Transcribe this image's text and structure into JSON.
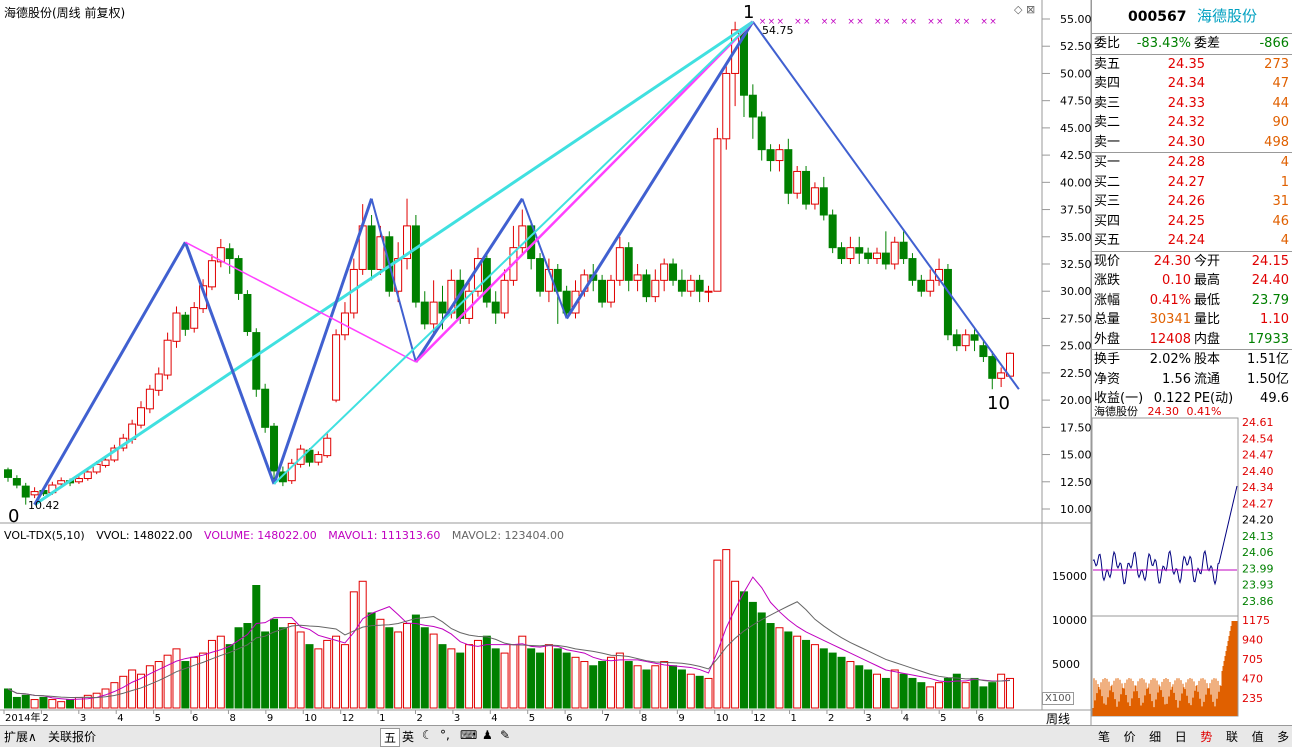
{
  "title": "海德股份(周线 前复权)",
  "volume_legend": {
    "indicator": "VOL-TDX(5,10)",
    "vvol": "VVOL: 148022.00",
    "volume": "VOLUME: 148022.00",
    "mavol1": "MAVOL1: 111313.60",
    "mavol2": "MAVOL2: 123404.00"
  },
  "price_axis": [
    "55.00",
    "52.50",
    "50.00",
    "47.50",
    "45.00",
    "42.50",
    "40.00",
    "37.50",
    "35.00",
    "32.50",
    "30.00",
    "27.50",
    "25.00",
    "22.50",
    "20.00",
    "17.50",
    "15.00",
    "12.50",
    "10.00"
  ],
  "volume_axis": [
    "15000",
    "10000",
    "5000"
  ],
  "x_labels": [
    "2014年",
    "2",
    "3",
    "4",
    "5",
    "6",
    "8",
    "9",
    "10",
    "12",
    "1",
    "2",
    "3",
    "4",
    "5",
    "6",
    "7",
    "8",
    "9",
    "10",
    "12",
    "1",
    "2",
    "3",
    "4",
    "5",
    "6"
  ],
  "period_label": "周线",
  "x100_label": "X100",
  "annotations": {
    "wave_start": "0",
    "wave_peak": "1",
    "wave_end": "10",
    "low_price": "10.42",
    "high_price": "54.75"
  },
  "quote": {
    "code": "000567",
    "name": "海德股份",
    "rows": [
      {
        "l": "委比",
        "v": "-83.43%",
        "l2": "委差",
        "v2": "-866",
        "c1": "green",
        "c2": "green"
      },
      {
        "l": "卖五",
        "v": "24.35",
        "v2": "273",
        "c1": "red",
        "c2": "orange"
      },
      {
        "l": "卖四",
        "v": "24.34",
        "v2": "47",
        "c1": "red",
        "c2": "orange"
      },
      {
        "l": "卖三",
        "v": "24.33",
        "v2": "44",
        "c1": "red",
        "c2": "orange"
      },
      {
        "l": "卖二",
        "v": "24.32",
        "v2": "90",
        "c1": "red",
        "c2": "orange"
      },
      {
        "l": "卖一",
        "v": "24.30",
        "v2": "498",
        "c1": "red",
        "c2": "orange"
      },
      {
        "l": "买一",
        "v": "24.28",
        "v2": "4",
        "c1": "red",
        "c2": "orange"
      },
      {
        "l": "买二",
        "v": "24.27",
        "v2": "1",
        "c1": "red",
        "c2": "orange"
      },
      {
        "l": "买三",
        "v": "24.26",
        "v2": "31",
        "c1": "red",
        "c2": "orange"
      },
      {
        "l": "买四",
        "v": "24.25",
        "v2": "46",
        "c1": "red",
        "c2": "orange"
      },
      {
        "l": "买五",
        "v": "24.24",
        "v2": "4",
        "c1": "red",
        "c2": "orange"
      },
      {
        "l": "现价",
        "v": "24.30",
        "l2": "今开",
        "v2": "24.15",
        "c1": "red",
        "c2": "red"
      },
      {
        "l": "涨跌",
        "v": "0.10",
        "l2": "最高",
        "v2": "24.40",
        "c1": "red",
        "c2": "red"
      },
      {
        "l": "涨幅",
        "v": "0.41%",
        "l2": "最低",
        "v2": "23.79",
        "c1": "red",
        "c2": "green"
      },
      {
        "l": "总量",
        "v": "30341",
        "l2": "量比",
        "v2": "1.10",
        "c1": "orange",
        "c2": "red"
      },
      {
        "l": "外盘",
        "v": "12408",
        "l2": "内盘",
        "v2": "17933",
        "c1": "red",
        "c2": "green"
      },
      {
        "l": "换手",
        "v": "2.02%",
        "l2": "股本",
        "v2": "1.51亿",
        "c1": "black",
        "c2": "black"
      },
      {
        "l": "净资",
        "v": "1.56",
        "l2": "流通",
        "v2": "1.50亿",
        "c1": "black",
        "c2": "black"
      },
      {
        "l": "收益(一)",
        "v": "0.122",
        "l2": "PE(动)",
        "v2": "49.6",
        "c1": "black",
        "c2": "black"
      }
    ]
  },
  "intraday": {
    "name": "海德股份",
    "price": "24.30",
    "change": "0.41%",
    "price_axis": [
      "24.61",
      "24.54",
      "24.47",
      "24.40",
      "24.34",
      "24.27",
      "24.20",
      "24.13",
      "24.06",
      "23.99",
      "23.93",
      "23.86"
    ],
    "vol_axis": [
      "1175",
      "940",
      "705",
      "470",
      "235"
    ]
  },
  "bottom_tabs": [
    "扩展∧",
    "关联报价"
  ],
  "toolbar": [
    "五",
    "英"
  ],
  "right_tabs": [
    "笔",
    "价",
    "细",
    "日",
    "势",
    "联",
    "值",
    "多"
  ],
  "chart_data": {
    "type": "candlestick",
    "title": "海德股份(周线 前复权)",
    "ylim": [
      8,
      56
    ],
    "candles": [
      [
        13.6,
        12.9,
        13.8,
        12.5
      ],
      [
        12.8,
        12.2,
        13.1,
        11.9
      ],
      [
        12.1,
        11.1,
        12.4,
        10.4
      ],
      [
        11.3,
        11.6,
        12.0,
        11.0
      ],
      [
        11.7,
        11.4,
        11.9,
        11.2
      ],
      [
        11.5,
        12.2,
        12.5,
        11.3
      ],
      [
        12.3,
        12.6,
        12.9,
        12.1
      ],
      [
        12.6,
        12.4,
        12.8,
        12.1
      ],
      [
        12.5,
        12.8,
        13.0,
        12.3
      ],
      [
        12.8,
        13.4,
        13.7,
        12.6
      ],
      [
        13.4,
        14.1,
        14.4,
        13.2
      ],
      [
        14.0,
        14.5,
        14.9,
        13.8
      ],
      [
        14.5,
        15.6,
        15.9,
        14.3
      ],
      [
        15.6,
        16.5,
        16.9,
        15.3
      ],
      [
        16.4,
        17.8,
        18.2,
        16.0
      ],
      [
        17.7,
        19.3,
        19.9,
        17.4
      ],
      [
        19.2,
        21.0,
        21.4,
        18.8
      ],
      [
        20.9,
        22.4,
        23.0,
        20.4
      ],
      [
        22.3,
        25.5,
        26.2,
        21.9
      ],
      [
        25.4,
        28.0,
        28.6,
        24.8
      ],
      [
        27.8,
        26.5,
        28.1,
        25.9
      ],
      [
        26.6,
        28.5,
        29.0,
        26.2
      ],
      [
        28.4,
        30.5,
        31.1,
        28.0
      ],
      [
        30.4,
        32.8,
        33.4,
        30.1
      ],
      [
        32.7,
        34.0,
        34.8,
        32.2
      ],
      [
        33.9,
        33.0,
        34.4,
        31.6
      ],
      [
        33.0,
        29.8,
        33.3,
        29.2
      ],
      [
        29.7,
        26.3,
        30.1,
        25.9
      ],
      [
        26.2,
        21.0,
        26.6,
        20.3
      ],
      [
        21.0,
        17.5,
        21.5,
        17.0
      ],
      [
        17.6,
        13.5,
        17.9,
        12.3
      ],
      [
        13.4,
        12.5,
        13.9,
        12.1
      ],
      [
        12.6,
        14.2,
        14.6,
        12.3
      ],
      [
        14.1,
        15.5,
        15.9,
        13.8
      ],
      [
        15.4,
        14.3,
        15.6,
        13.9
      ],
      [
        14.3,
        15.0,
        15.3,
        14.0
      ],
      [
        14.9,
        16.5,
        17.0,
        14.7
      ],
      [
        20.0,
        26.0,
        26.5,
        19.8
      ],
      [
        26.0,
        28.0,
        29.0,
        25.5
      ],
      [
        28.0,
        32.0,
        33.0,
        27.5
      ],
      [
        32.0,
        36.0,
        38.0,
        31.5
      ],
      [
        36.0,
        32.0,
        37.0,
        31.0
      ],
      [
        32.0,
        35.0,
        36.0,
        31.5
      ],
      [
        35.0,
        30.0,
        35.5,
        29.5
      ],
      [
        30.0,
        33.0,
        34.5,
        29.0
      ],
      [
        33.0,
        36.0,
        38.5,
        32.0
      ],
      [
        36.0,
        29.0,
        37.0,
        28.5
      ],
      [
        29.0,
        27.0,
        30.0,
        26.5
      ],
      [
        27.0,
        29.0,
        31.0,
        26.0
      ],
      [
        29.0,
        28.0,
        30.5,
        26.5
      ],
      [
        28.0,
        31.0,
        32.0,
        27.5
      ],
      [
        31.0,
        27.5,
        32.0,
        27.0
      ],
      [
        27.5,
        30.0,
        31.0,
        27.0
      ],
      [
        30.0,
        33.0,
        34.0,
        29.5
      ],
      [
        33.0,
        29.0,
        33.5,
        28.5
      ],
      [
        29.0,
        28.0,
        30.0,
        27.0
      ],
      [
        28.0,
        31.0,
        32.0,
        27.5
      ],
      [
        31.0,
        34.0,
        36.0,
        30.5
      ],
      [
        34.0,
        36.0,
        37.5,
        33.5
      ],
      [
        36.0,
        33.0,
        36.5,
        32.0
      ],
      [
        33.0,
        30.0,
        33.5,
        29.5
      ],
      [
        30.0,
        32.0,
        33.0,
        29.0
      ],
      [
        32.0,
        30.0,
        32.5,
        27.0
      ],
      [
        30.0,
        28.0,
        30.5,
        27.5
      ],
      [
        28.0,
        30.0,
        31.0,
        27.5
      ],
      [
        30.0,
        31.5,
        32.0,
        29.5
      ],
      [
        31.5,
        31.0,
        32.5,
        30.0
      ],
      [
        31.0,
        29.0,
        31.5,
        28.5
      ],
      [
        29.0,
        31.0,
        31.5,
        28.5
      ],
      [
        31.0,
        34.0,
        35.0,
        30.5
      ],
      [
        34.0,
        31.0,
        34.5,
        30.0
      ],
      [
        31.0,
        31.5,
        32.5,
        30.0
      ],
      [
        31.5,
        29.5,
        32.0,
        29.0
      ],
      [
        29.5,
        31.0,
        32.0,
        29.0
      ],
      [
        31.0,
        32.5,
        33.0,
        30.0
      ],
      [
        32.5,
        31.0,
        33.0,
        30.5
      ],
      [
        31.0,
        30.0,
        32.0,
        29.5
      ],
      [
        30.0,
        31.0,
        31.5,
        29.5
      ],
      [
        31.0,
        30.0,
        31.5,
        29.0
      ],
      [
        30.0,
        30.0,
        30.5,
        29.0
      ],
      [
        30.0,
        44.0,
        45.0,
        30.0
      ],
      [
        44.0,
        50.0,
        51.0,
        43.0
      ],
      [
        50.0,
        54.0,
        54.75,
        47.0
      ],
      [
        54.0,
        48.0,
        54.0,
        46.0
      ],
      [
        48.0,
        46.0,
        49.0,
        44.0
      ],
      [
        46.0,
        43.0,
        46.5,
        42.0
      ],
      [
        43.0,
        42.0,
        43.5,
        41.0
      ],
      [
        42.0,
        43.0,
        43.5,
        41.0
      ],
      [
        43.0,
        39.0,
        44.0,
        38.0
      ],
      [
        39.0,
        41.0,
        41.5,
        38.5
      ],
      [
        41.0,
        38.0,
        41.5,
        37.5
      ],
      [
        38.0,
        39.5,
        40.0,
        37.5
      ],
      [
        39.5,
        37.0,
        40.5,
        36.5
      ],
      [
        37.0,
        34.0,
        37.5,
        33.5
      ],
      [
        34.0,
        33.0,
        34.5,
        32.5
      ],
      [
        33.0,
        34.0,
        35.0,
        32.5
      ],
      [
        34.0,
        33.5,
        35.0,
        32.5
      ],
      [
        33.5,
        33.0,
        34.0,
        32.5
      ],
      [
        33.0,
        33.5,
        34.0,
        32.5
      ],
      [
        33.5,
        32.5,
        35.5,
        32.0
      ],
      [
        32.5,
        34.5,
        35.0,
        32.0
      ],
      [
        34.5,
        33.0,
        35.5,
        32.5
      ],
      [
        33.0,
        31.0,
        33.5,
        30.5
      ],
      [
        31.0,
        30.0,
        31.5,
        29.5
      ],
      [
        30.0,
        31.0,
        32.0,
        29.5
      ],
      [
        31.0,
        32.0,
        33.0,
        30.5
      ],
      [
        32.0,
        26.0,
        32.5,
        25.5
      ],
      [
        26.0,
        25.0,
        26.5,
        24.5
      ],
      [
        25.0,
        26.0,
        26.5,
        24.5
      ],
      [
        26.0,
        25.5,
        26.5,
        24.5
      ],
      [
        25.0,
        24.0,
        25.5,
        23.5
      ],
      [
        24.0,
        22.0,
        24.5,
        21.0
      ],
      [
        22.0,
        22.5,
        23.0,
        21.2
      ],
      [
        22.2,
        24.3,
        24.4,
        22.0
      ]
    ],
    "volume": [
      9,
      5,
      6,
      4,
      5,
      4,
      3,
      4,
      5,
      6,
      7,
      9,
      12,
      15,
      18,
      16,
      20,
      22,
      25,
      28,
      22,
      24,
      26,
      32,
      34,
      30,
      38,
      40,
      58,
      36,
      42,
      38,
      40,
      36,
      30,
      28,
      32,
      34,
      30,
      55,
      60,
      45,
      42,
      38,
      36,
      40,
      44,
      38,
      35,
      30,
      28,
      26,
      30,
      32,
      34,
      28,
      26,
      30,
      34,
      28,
      26,
      30,
      28,
      26,
      24,
      22,
      20,
      22,
      24,
      26,
      22,
      20,
      18,
      20,
      22,
      20,
      18,
      16,
      15,
      14,
      70,
      75,
      60,
      55,
      50,
      45,
      40,
      38,
      36,
      34,
      32,
      30,
      28,
      26,
      24,
      22,
      20,
      18,
      16,
      14,
      18,
      16,
      14,
      12,
      10,
      12,
      14,
      16,
      12,
      14,
      10,
      12,
      16,
      14
    ]
  }
}
